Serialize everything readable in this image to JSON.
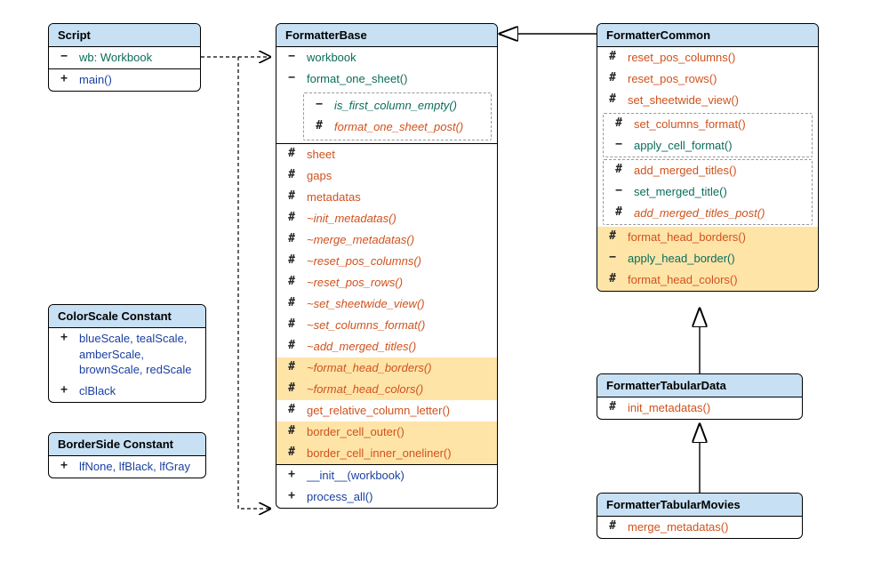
{
  "classes": {
    "script": {
      "title": "Script",
      "attrs": [
        {
          "vis": "minus",
          "text": "wb: Workbook",
          "cls": "c-teal"
        }
      ],
      "ops": [
        {
          "vis": "plus",
          "text": "main()",
          "cls": "c-blue"
        }
      ]
    },
    "colorscale": {
      "title": "ColorScale Constant",
      "attrs": [
        {
          "vis": "plus",
          "text": "blueScale, tealScale, amberScale, brownScale, redScale",
          "cls": "c-blue"
        },
        {
          "vis": "plus",
          "text": "clBlack",
          "cls": "c-blue"
        }
      ]
    },
    "borderside": {
      "title": "BorderSide Constant",
      "attrs": [
        {
          "vis": "plus",
          "text": "lfNone, lfBlack, lfGray",
          "cls": "c-blue"
        }
      ]
    },
    "formatterBase": {
      "title": "FormatterBase",
      "priv": [
        {
          "vis": "minus",
          "text": "workbook",
          "cls": "c-teal"
        }
      ],
      "privGroup": {
        "head": {
          "vis": "minus",
          "text": "format_one_sheet()",
          "cls": "c-teal"
        },
        "children": [
          {
            "vis": "minus",
            "text": "is_first_column_empty()",
            "cls": "c-teal ital"
          },
          {
            "vis": "hash",
            "text": "format_one_sheet_post()",
            "cls": "c-orange ital"
          }
        ]
      },
      "prot": [
        {
          "vis": "hash",
          "text": "sheet",
          "cls": "c-orange"
        },
        {
          "vis": "hash",
          "text": "gaps",
          "cls": "c-orange"
        },
        {
          "vis": "hash",
          "text": "metadatas",
          "cls": "c-orange"
        },
        {
          "vis": "hash",
          "text": "~init_metadatas()",
          "cls": "c-orange ital"
        },
        {
          "vis": "hash",
          "text": "~merge_metadatas()",
          "cls": "c-orange ital"
        },
        {
          "vis": "hash",
          "text": "~reset_pos_columns()",
          "cls": "c-orange ital"
        },
        {
          "vis": "hash",
          "text": "~reset_pos_rows()",
          "cls": "c-orange ital"
        },
        {
          "vis": "hash",
          "text": "~set_sheetwide_view()",
          "cls": "c-orange ital"
        },
        {
          "vis": "hash",
          "text": "~set_columns_format()",
          "cls": "c-orange ital"
        },
        {
          "vis": "hash",
          "text": "~add_merged_titles()",
          "cls": "c-orange ital"
        },
        {
          "vis": "hash",
          "text": "~format_head_borders()",
          "cls": "c-orange ital",
          "hl": true
        },
        {
          "vis": "hash",
          "text": "~format_head_colors()",
          "cls": "c-orange ital",
          "hl": true
        },
        {
          "vis": "hash",
          "text": "get_relative_column_letter()",
          "cls": "c-orange"
        },
        {
          "vis": "hash",
          "text": "border_cell_outer()",
          "cls": "c-orange",
          "hl": true
        },
        {
          "vis": "hash",
          "text": "border_cell_inner_oneliner()",
          "cls": "c-orange",
          "hl": true
        }
      ],
      "pub": [
        {
          "vis": "plus",
          "text": "__init__(workbook)",
          "cls": "c-blue"
        },
        {
          "vis": "plus",
          "text": "process_all()",
          "cls": "c-blue"
        }
      ]
    },
    "formatterCommon": {
      "title": "FormatterCommon",
      "plain": [
        {
          "vis": "hash",
          "text": "reset_pos_columns()",
          "cls": "c-orange"
        },
        {
          "vis": "hash",
          "text": "reset_pos_rows()",
          "cls": "c-orange"
        },
        {
          "vis": "hash",
          "text": "set_sheetwide_view()",
          "cls": "c-orange"
        }
      ],
      "group1": {
        "head": {
          "vis": "hash",
          "text": "set_columns_format()",
          "cls": "c-orange"
        },
        "children": [
          {
            "vis": "minus",
            "text": "apply_cell_format()",
            "cls": "c-teal"
          }
        ]
      },
      "group2": {
        "head": {
          "vis": "hash",
          "text": "add_merged_titles()",
          "cls": "c-orange"
        },
        "children": [
          {
            "vis": "minus",
            "text": "set_merged_title()",
            "cls": "c-teal"
          },
          {
            "vis": "hash",
            "text": "add_merged_titles_post()",
            "cls": "c-orange ital"
          }
        ]
      },
      "hlrows": [
        {
          "vis": "hash",
          "text": "format_head_borders()",
          "cls": "c-orange",
          "hl": true
        },
        {
          "vis": "minus",
          "text": "apply_head_border()",
          "cls": "c-teal",
          "hl": true,
          "indent": true
        },
        {
          "vis": "hash",
          "text": "format_head_colors()",
          "cls": "c-orange",
          "hl": true
        }
      ]
    },
    "formatterTabData": {
      "title": "FormatterTabularData",
      "ops": [
        {
          "vis": "hash",
          "text": "init_metadatas()",
          "cls": "c-orange"
        }
      ]
    },
    "formatterTabMovies": {
      "title": "FormatterTabularMovies",
      "ops": [
        {
          "vis": "hash",
          "text": "merge_metadatas()",
          "cls": "c-orange"
        }
      ]
    }
  }
}
